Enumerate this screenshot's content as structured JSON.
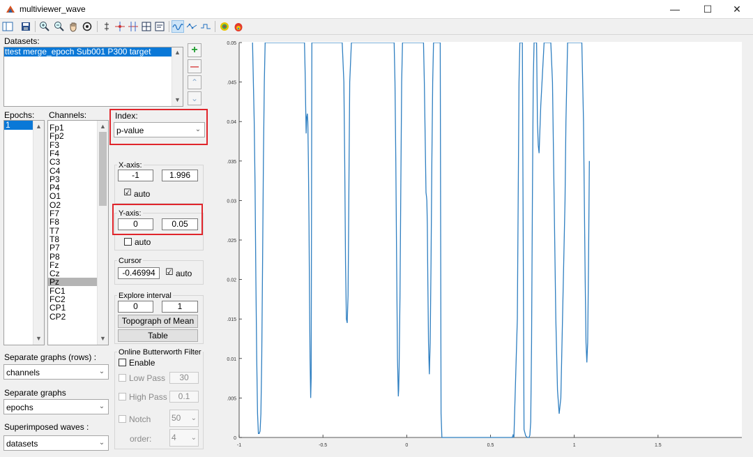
{
  "window": {
    "title": "multiviewer_wave",
    "minimize_glyph": "—",
    "maximize_glyph": "☐",
    "close_glyph": "✕"
  },
  "toolbar": {
    "icons": [
      "layout-icon",
      "save-icon",
      "zoom-in-icon",
      "zoom-out-icon",
      "pan-icon",
      "rotate-icon",
      "cursor-icon",
      "channel-icon",
      "channel-select-icon",
      "grid-icon",
      "table-icon",
      "wave-icon",
      "wave-dots-icon",
      "wave-step-icon",
      "topography-icon",
      "headmap-icon"
    ]
  },
  "datasets": {
    "label": "Datasets:",
    "items": [
      "ttest merge_epoch Sub001 P300 target"
    ],
    "selected_index": 0,
    "add_glyph": "+",
    "remove_glyph": "—",
    "up_glyph": "⌃",
    "down_glyph": "⌄"
  },
  "epochs": {
    "label": "Epochs:",
    "items": [
      "1"
    ]
  },
  "channels": {
    "label": "Channels:",
    "items": [
      "Fp1",
      "Fp2",
      "F3",
      "F4",
      "C3",
      "C4",
      "P3",
      "P4",
      "O1",
      "O2",
      "F7",
      "F8",
      "T7",
      "T8",
      "P7",
      "P8",
      "Fz",
      "Cz",
      "Pz",
      "FC1",
      "FC2",
      "CP1",
      "CP2"
    ],
    "selected": "Pz"
  },
  "index": {
    "label": "Index:",
    "value": "p-value"
  },
  "xaxis": {
    "title": "X-axis:",
    "min": "-1",
    "max": "1.996",
    "auto_label": "auto",
    "auto_checked": "☑"
  },
  "yaxis": {
    "title": "Y-axis:",
    "min": "0",
    "max": "0.05",
    "auto_label": "auto"
  },
  "cursor": {
    "title": "Cursor",
    "value": "-0.46994",
    "auto_label": "auto",
    "auto_checked": "☑"
  },
  "explore": {
    "title": "Explore interval",
    "start": "0",
    "end": "1",
    "topograph_label": "Topograph of Mean",
    "table_label": "Table"
  },
  "filter": {
    "title": "Online Butterworth Filter",
    "enable_label": "Enable",
    "lowpass_label": "Low Pass",
    "lowpass_value": "30",
    "highpass_label": "High Pass",
    "highpass_value": "0.1",
    "notch_label": "Notch",
    "notch_value": "50",
    "order_label": "order:",
    "order_value": "4"
  },
  "separate_rows": {
    "label": "Separate graphs (rows) :",
    "value": "channels"
  },
  "separate_graphs": {
    "label": "Separate graphs",
    "value": "epochs"
  },
  "superimposed": {
    "label": "Superimposed waves :",
    "value": "datasets"
  },
  "chart_data": {
    "type": "line",
    "xlim": [
      -1,
      2
    ],
    "ylim": [
      0,
      0.05
    ],
    "xticks": [
      "-1",
      "-0.5",
      "0",
      "0.5",
      "1",
      "1.5"
    ],
    "xtick_values": [
      -1,
      -0.5,
      0,
      0.5,
      1,
      1.5
    ],
    "yticks": [
      "0",
      ".005",
      "0.01",
      ".015",
      "0.02",
      ".025",
      "0.03",
      ".035",
      "0.04",
      ".045",
      "0.05"
    ],
    "ytick_values": [
      0,
      0.005,
      0.01,
      0.015,
      0.02,
      0.025,
      0.03,
      0.035,
      0.04,
      0.045,
      0.05
    ],
    "grid": false,
    "color": "#2f7fc1",
    "series": [
      {
        "x": [
          -0.92,
          -0.91,
          -0.905,
          -0.9,
          -0.895,
          -0.89,
          -0.885,
          -0.88,
          -0.875,
          -0.87,
          -0.865,
          -0.86,
          -0.855,
          -0.85,
          -0.845,
          -0.84,
          -0.83,
          -0.61,
          -0.606,
          -0.603,
          -0.6,
          -0.597,
          -0.593,
          -0.59,
          -0.587,
          -0.583,
          -0.58,
          -0.577,
          -0.573,
          -0.57,
          -0.566,
          -0.405,
          -0.395,
          -0.385,
          -0.375,
          -0.37,
          -0.365,
          -0.36,
          -0.355,
          -0.35,
          -0.347,
          -0.344,
          -0.34,
          -0.33,
          -0.08,
          -0.075,
          -0.07,
          -0.065,
          -0.06,
          -0.055,
          -0.05,
          -0.048,
          -0.045,
          -0.04,
          -0.035,
          -0.03,
          -0.025,
          -0.02,
          0.1,
          0.105,
          0.11,
          0.115,
          0.118,
          0.12,
          0.123,
          0.126,
          0.13,
          0.135,
          0.14,
          0.145,
          0.15,
          0.155,
          0.16,
          0.165,
          0.17,
          0.175,
          0.18,
          0.185,
          0.19,
          0.195,
          0.2,
          0.205,
          0.21,
          0.215,
          0.62,
          0.625,
          0.63,
          0.635,
          0.64,
          0.66,
          0.665,
          0.67,
          0.675,
          0.68,
          0.685,
          0.69,
          0.7,
          0.71,
          0.72,
          0.725,
          0.73,
          0.735,
          0.74,
          0.745,
          0.75,
          0.755,
          0.76,
          0.765,
          0.775,
          0.78,
          0.785,
          0.79,
          0.8,
          0.82,
          0.83,
          0.84,
          0.85,
          0.86,
          0.87,
          0.88,
          0.89,
          0.9,
          0.91,
          0.92,
          0.93,
          0.945,
          0.95,
          0.955,
          0.96,
          0.965,
          0.97,
          0.975,
          1.04,
          1.045,
          1.05,
          1.055,
          1.06,
          1.065,
          1.07,
          1.075,
          1.08,
          1.085,
          1.09
        ],
        "y": [
          0.05,
          0.04,
          0.032,
          0.02,
          0.01,
          0.003,
          0.0005,
          0.0005,
          0.0008,
          0.003,
          0.01,
          0.022,
          0.035,
          0.045,
          0.05,
          0.05,
          0.05,
          0.05,
          0.046,
          0.042,
          0.0385,
          0.0405,
          0.041,
          0.04,
          0.035,
          0.027,
          0.018,
          0.01,
          0.005,
          0.0075,
          0.05,
          0.05,
          0.05,
          0.05,
          0.045,
          0.035,
          0.022,
          0.015,
          0.0145,
          0.018,
          0.025,
          0.035,
          0.045,
          0.05,
          0.05,
          0.05,
          0.045,
          0.035,
          0.022,
          0.01,
          0.0052,
          0.006,
          0.009,
          0.018,
          0.032,
          0.045,
          0.05,
          0.05,
          0.05,
          0.045,
          0.038,
          0.031,
          0.0305,
          0.03,
          0.027,
          0.02,
          0.012,
          0.008,
          0.012,
          0.022,
          0.035,
          0.045,
          0.05,
          0.05,
          0.05,
          0.05,
          0.05,
          0.05,
          0.05,
          0.05,
          0.05,
          0.003,
          0,
          0,
          0,
          0,
          0,
          0.0003,
          0,
          0.015,
          0.03,
          0.045,
          0.05,
          0.05,
          0.05,
          0.05,
          0.001,
          0.0002,
          0,
          0,
          0,
          0.0003,
          0.002,
          0.012,
          0.03,
          0.045,
          0.05,
          0.05,
          0.05,
          0.04,
          0.037,
          0.036,
          0.042,
          0.05,
          0.05,
          0.05,
          0.05,
          0.05,
          0.045,
          0.03,
          0.015,
          0.006,
          0.003,
          0.005,
          0.015,
          0.03,
          0.04,
          0.045,
          0.05,
          0.05,
          0.05,
          0.05,
          0.05,
          0.05,
          0.045,
          0.04,
          0.03,
          0.02,
          0.012,
          0.0095,
          0.012,
          0.022,
          0.035
        ]
      }
    ]
  }
}
